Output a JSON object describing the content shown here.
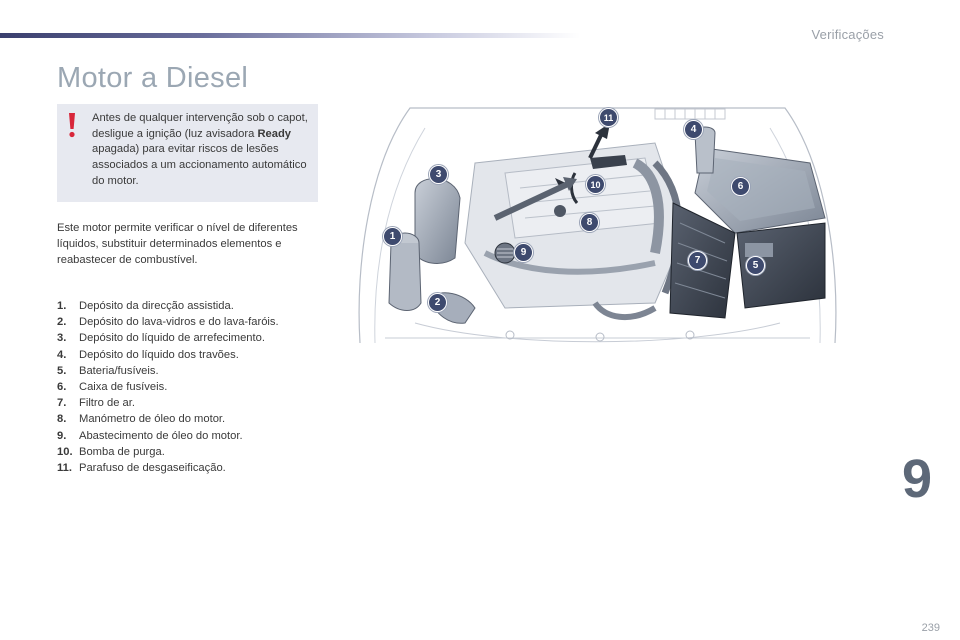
{
  "header": {
    "section": "Verificações"
  },
  "title": "Motor a Diesel",
  "warning": {
    "before": "Antes de qualquer intervenção sob o capot, desligue a ignição (luz avisadora ",
    "bold": "Ready",
    "after": " apagada) para evitar riscos de lesões associados a um accionamento automático do motor."
  },
  "intro": "Este motor permite verificar o nível de diferentes líquidos, substituir determinados elementos e reabastecer de combustível.",
  "legend": [
    {
      "num": "1.",
      "text": "Depósito da direcção assistida."
    },
    {
      "num": "2.",
      "text": "Depósito do lava-vidros e do lava-faróis."
    },
    {
      "num": "3.",
      "text": "Depósito do líquido de arrefecimento."
    },
    {
      "num": "4.",
      "text": "Depósito do líquido dos travões."
    },
    {
      "num": "5.",
      "text": "Bateria/fusíveis."
    },
    {
      "num": "6.",
      "text": "Caixa de fusíveis."
    },
    {
      "num": "7.",
      "text": "Filtro de ar."
    },
    {
      "num": "8.",
      "text": "Manómetro de óleo do motor."
    },
    {
      "num": "9.",
      "text": "Abastecimento de óleo do motor."
    },
    {
      "num": "10.",
      "text": "Bomba de purga."
    },
    {
      "num": "11.",
      "text": "Parafuso de desgaseificação."
    }
  ],
  "callouts": [
    "1",
    "2",
    "3",
    "4",
    "5",
    "6",
    "7",
    "8",
    "9",
    "10",
    "11"
  ],
  "chapter": "9",
  "page": "239",
  "colors": {
    "accent": "#3e4a6e",
    "warning_bg": "#e7e9f0",
    "warning_mark": "#d8263a",
    "title": "#9ba7b3"
  }
}
